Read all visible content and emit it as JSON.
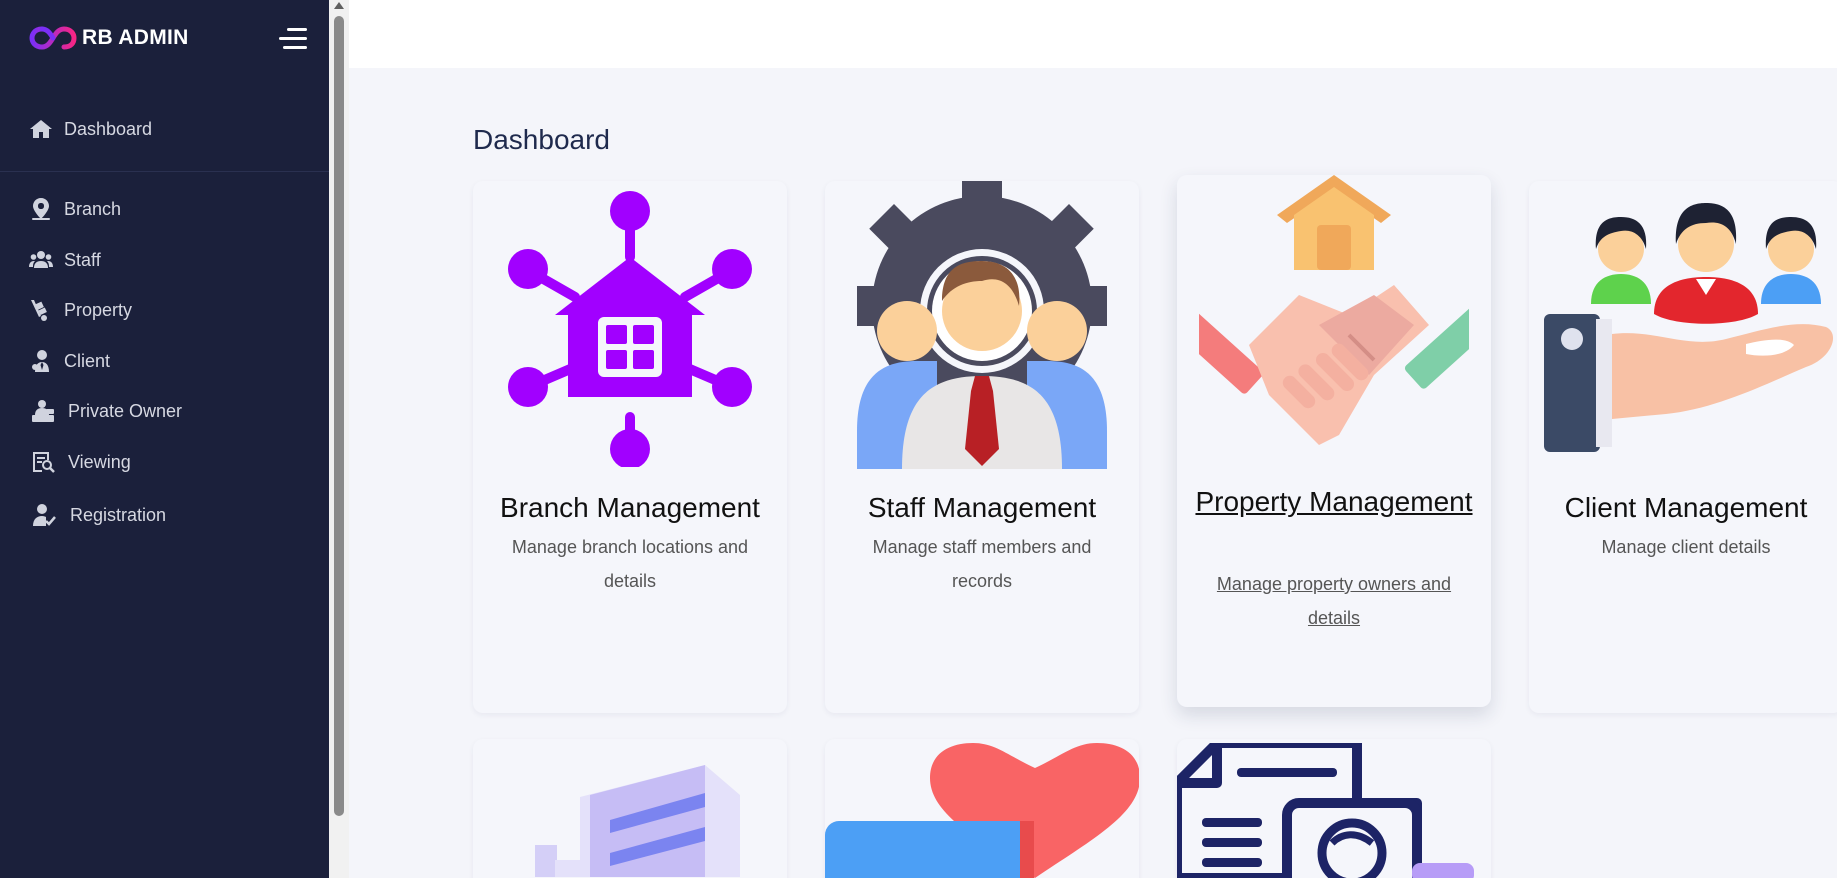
{
  "brand": {
    "name": "RB ADMIN",
    "logo_icon": "infinity-logo-icon"
  },
  "sidebar": {
    "items": [
      {
        "label": "Dashboard",
        "icon": "home-icon"
      },
      {
        "label": "Branch",
        "icon": "map-pin-icon"
      },
      {
        "label": "Staff",
        "icon": "users-icon"
      },
      {
        "label": "Property",
        "icon": "dolly-icon"
      },
      {
        "label": "Client",
        "icon": "user-tie-icon"
      },
      {
        "label": "Private Owner",
        "icon": "person-desk-icon"
      },
      {
        "label": "Viewing",
        "icon": "search-document-icon"
      },
      {
        "label": "Registration",
        "icon": "user-check-icon"
      }
    ]
  },
  "page": {
    "title": "Dashboard"
  },
  "cards": [
    {
      "title": "Branch Management",
      "description": "Manage branch locations and details",
      "icon": "branch-network-icon"
    },
    {
      "title": "Staff Management",
      "description": "Manage staff members and records",
      "icon": "staff-gear-icon"
    },
    {
      "title": "Property Management",
      "description": "Manage property owners and details",
      "icon": "handshake-house-icon"
    },
    {
      "title": "Client Management",
      "description": "Manage client details",
      "icon": "clients-hand-icon"
    }
  ],
  "lower_cards": [
    {
      "icon": "building-icon"
    },
    {
      "icon": "heart-card-icon"
    },
    {
      "icon": "document-avatar-icon"
    }
  ],
  "colors": {
    "sidebar_bg": "#1b203b",
    "page_bg": "#f4f5fa",
    "accent_purple": "#a100ff",
    "title_color": "#1f2a4d"
  }
}
